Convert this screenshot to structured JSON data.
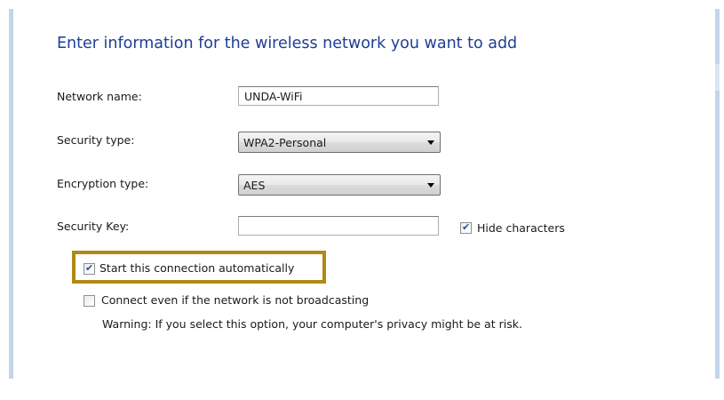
{
  "title": "Enter information for the wireless network you want to add",
  "network_name": {
    "label": "Network name:",
    "value": "UNDA-WiFi"
  },
  "security_type": {
    "label": "Security type:",
    "selected": "WPA2-Personal"
  },
  "encryption_type": {
    "label": "Encryption type:",
    "selected": "AES"
  },
  "security_key": {
    "label": "Security Key:",
    "value": ""
  },
  "hide_characters": {
    "label": "Hide characters",
    "checked": true
  },
  "start_automatically": {
    "label": "Start this connection automatically",
    "checked": true
  },
  "connect_not_broadcasting": {
    "label": "Connect even if the network is not broadcasting",
    "checked": false
  },
  "warning": "Warning: If you select this option, your computer's privacy might be at risk.",
  "colors": {
    "title": "#1e3e96",
    "highlight": "#b08a12",
    "window_edge": "#c4d5ea"
  }
}
